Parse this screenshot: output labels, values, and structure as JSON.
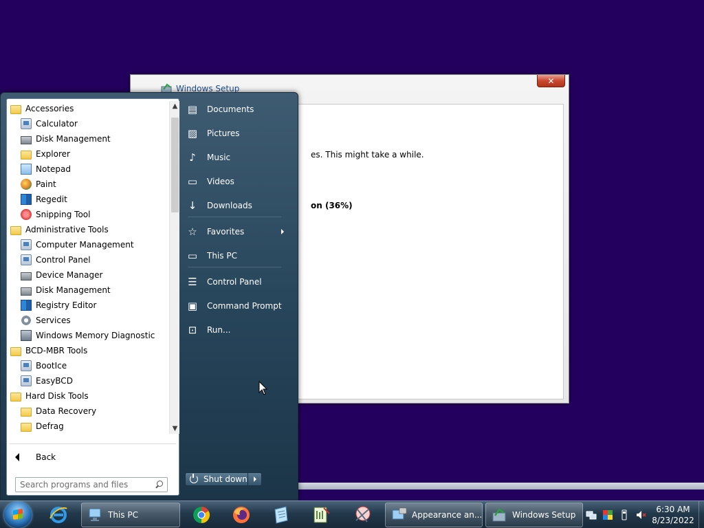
{
  "setup_window": {
    "title": "Windows Setup",
    "close_label": "✕",
    "message": "es. This might take a while.",
    "progress_text": "on (36%)"
  },
  "start_menu": {
    "programs": [
      {
        "label": "Accessories",
        "level": 0,
        "icon": "folder-icon"
      },
      {
        "label": "Calculator",
        "level": 1,
        "icon": "calculator-icon"
      },
      {
        "label": "Disk Management",
        "level": 1,
        "icon": "disk-icon"
      },
      {
        "label": "Explorer",
        "level": 1,
        "icon": "explorer-icon"
      },
      {
        "label": "Notepad",
        "level": 1,
        "icon": "notepad-icon"
      },
      {
        "label": "Paint",
        "level": 1,
        "icon": "paint-icon"
      },
      {
        "label": "Regedit",
        "level": 1,
        "icon": "regedit-icon"
      },
      {
        "label": "Snipping Tool",
        "level": 1,
        "icon": "snipping-icon"
      },
      {
        "label": "Administrative Tools",
        "level": 0,
        "icon": "folder-icon"
      },
      {
        "label": "Computer Management",
        "level": 1,
        "icon": "computer-management-icon"
      },
      {
        "label": "Control Panel",
        "level": 1,
        "icon": "control-panel-icon"
      },
      {
        "label": "Device Manager",
        "level": 1,
        "icon": "device-manager-icon"
      },
      {
        "label": "Disk Management",
        "level": 1,
        "icon": "disk-icon"
      },
      {
        "label": "Registry Editor",
        "level": 1,
        "icon": "regedit-icon"
      },
      {
        "label": "Services",
        "level": 1,
        "icon": "gear-icon"
      },
      {
        "label": "Windows Memory Diagnostic",
        "level": 1,
        "icon": "memory-icon"
      },
      {
        "label": "BCD-MBR Tools",
        "level": 0,
        "icon": "folder-icon"
      },
      {
        "label": "BootIce",
        "level": 1,
        "icon": "app-icon"
      },
      {
        "label": "EasyBCD",
        "level": 1,
        "icon": "app-icon"
      },
      {
        "label": "Hard Disk Tools",
        "level": 0,
        "icon": "folder-icon"
      },
      {
        "label": "Data Recovery",
        "level": 1,
        "icon": "folder-icon"
      },
      {
        "label": "Defrag",
        "level": 1,
        "icon": "folder-icon"
      }
    ],
    "back_label": "Back",
    "search_placeholder": "Search programs and files",
    "places": [
      {
        "label": "Documents",
        "icon": "documents-icon"
      },
      {
        "label": "Pictures",
        "icon": "pictures-icon"
      },
      {
        "label": "Music",
        "icon": "music-icon"
      },
      {
        "label": "Videos",
        "icon": "videos-icon"
      },
      {
        "label": "Downloads",
        "icon": "downloads-icon"
      },
      {
        "label": "Favorites",
        "icon": "star-icon"
      },
      {
        "label": "This PC",
        "icon": "computer-icon"
      },
      {
        "label": "Control Panel",
        "icon": "control-panel-icon"
      },
      {
        "label": "Command Prompt",
        "icon": "command-prompt-icon"
      },
      {
        "label": "Run...",
        "icon": "run-icon"
      }
    ],
    "shutdown_label": "Shut down"
  },
  "taskbar": {
    "pinned": [
      "internet-explorer-icon",
      "chrome-icon",
      "firefox-icon",
      "notepad-icon",
      "editor-icon",
      "snipping-icon"
    ],
    "tasks": [
      {
        "label": "This PC",
        "icon": "computer-icon"
      },
      {
        "label": "Appearance an...",
        "icon": "appearance-icon"
      },
      {
        "label": "Windows Setup",
        "icon": "setup-icon"
      }
    ],
    "tray": [
      "network-icon",
      "color-icon",
      "usb-icon",
      "volume-muted-icon"
    ],
    "clock": {
      "time": "6:30 AM",
      "date": "8/23/2022"
    }
  },
  "colors": {
    "desktop": "#24005e",
    "start_menu": "#28465c",
    "taskbar": "#22384b"
  }
}
